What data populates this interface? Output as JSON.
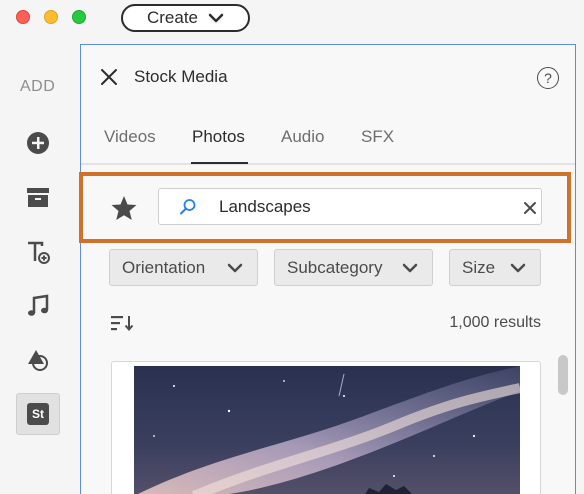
{
  "titlebar": {
    "create_label": "Create"
  },
  "rail": {
    "heading": "ADD",
    "items": [
      {
        "icon": "add-circle-icon"
      },
      {
        "icon": "archive-icon"
      },
      {
        "icon": "title-add-icon"
      },
      {
        "icon": "music-note-icon"
      },
      {
        "icon": "shapes-icon"
      },
      {
        "icon": "stock-icon",
        "label": "St"
      }
    ]
  },
  "panel": {
    "title": "Stock Media",
    "help_label": "?",
    "tabs": [
      {
        "label": "Videos"
      },
      {
        "label": "Photos",
        "active": true
      },
      {
        "label": "Audio"
      },
      {
        "label": "SFX"
      }
    ],
    "search": {
      "value": "Landscapes"
    },
    "filters": [
      {
        "label": "Orientation"
      },
      {
        "label": "Subcategory"
      },
      {
        "label": "Size"
      }
    ],
    "results_count": "1,000 results"
  },
  "colors": {
    "highlight": "#d0712b",
    "panel_border": "#5b8fd8",
    "search_icon": "#2680eb"
  }
}
